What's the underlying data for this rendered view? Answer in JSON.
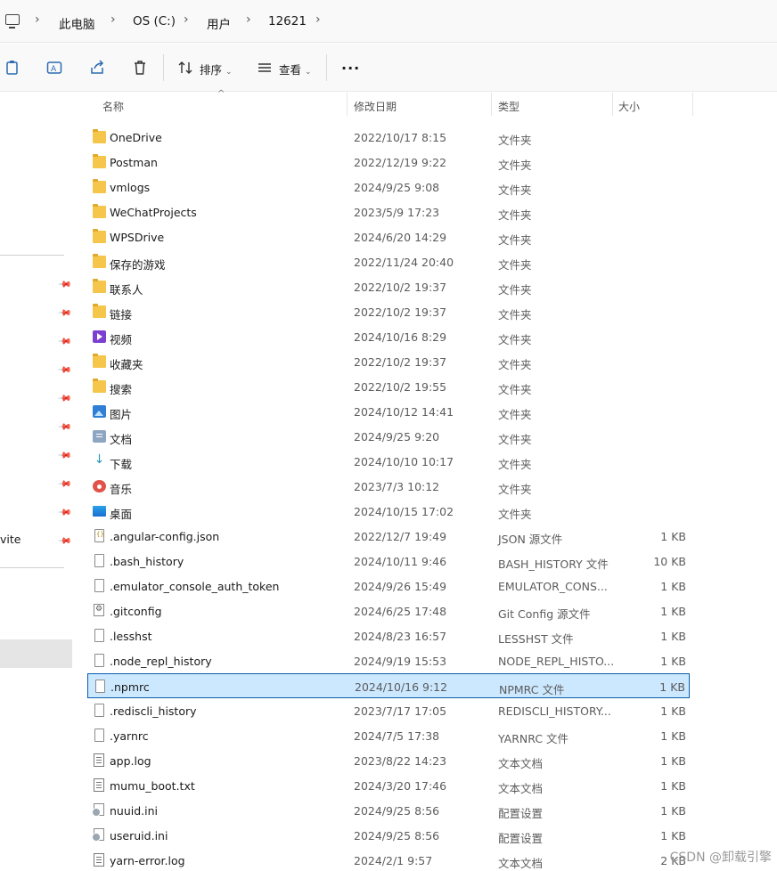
{
  "breadcrumb": {
    "items": [
      "此电脑",
      "OS (C:)",
      "用户",
      "12621"
    ]
  },
  "toolbar": {
    "sort_label": "排序",
    "view_label": "查看",
    "more_label": "···"
  },
  "sidebar": {
    "partial_label": "vite"
  },
  "columns": {
    "name": "名称",
    "date": "修改日期",
    "type": "类型",
    "size": "大小"
  },
  "rows": [
    {
      "icon": "folder",
      "name": "OneDrive",
      "date": "2022/10/17 8:15",
      "type": "文件夹",
      "size": ""
    },
    {
      "icon": "folder",
      "name": "Postman",
      "date": "2022/12/19 9:22",
      "type": "文件夹",
      "size": ""
    },
    {
      "icon": "folder",
      "name": "vmlogs",
      "date": "2024/9/25 9:08",
      "type": "文件夹",
      "size": ""
    },
    {
      "icon": "folder",
      "name": "WeChatProjects",
      "date": "2023/5/9 17:23",
      "type": "文件夹",
      "size": ""
    },
    {
      "icon": "folder",
      "name": "WPSDrive",
      "date": "2024/6/20 14:29",
      "type": "文件夹",
      "size": ""
    },
    {
      "icon": "folder",
      "name": "保存的游戏",
      "date": "2022/11/24 20:40",
      "type": "文件夹",
      "size": ""
    },
    {
      "icon": "folder",
      "name": "联系人",
      "date": "2022/10/2 19:37",
      "type": "文件夹",
      "size": ""
    },
    {
      "icon": "folder",
      "name": "链接",
      "date": "2022/10/2 19:37",
      "type": "文件夹",
      "size": ""
    },
    {
      "icon": "video",
      "name": "视频",
      "date": "2024/10/16 8:29",
      "type": "文件夹",
      "size": ""
    },
    {
      "icon": "folder",
      "name": "收藏夹",
      "date": "2022/10/2 19:37",
      "type": "文件夹",
      "size": ""
    },
    {
      "icon": "folder",
      "name": "搜索",
      "date": "2022/10/2 19:55",
      "type": "文件夹",
      "size": ""
    },
    {
      "icon": "pictures",
      "name": "图片",
      "date": "2024/10/12 14:41",
      "type": "文件夹",
      "size": ""
    },
    {
      "icon": "documents",
      "name": "文档",
      "date": "2024/9/25 9:20",
      "type": "文件夹",
      "size": ""
    },
    {
      "icon": "downloads",
      "name": "下载",
      "date": "2024/10/10 10:17",
      "type": "文件夹",
      "size": ""
    },
    {
      "icon": "music",
      "name": "音乐",
      "date": "2023/7/3 10:12",
      "type": "文件夹",
      "size": ""
    },
    {
      "icon": "desktop",
      "name": "桌面",
      "date": "2024/10/15 17:02",
      "type": "文件夹",
      "size": ""
    },
    {
      "icon": "json",
      "name": ".angular-config.json",
      "date": "2022/12/7 19:49",
      "type": "JSON 源文件",
      "size": "1 KB"
    },
    {
      "icon": "file",
      "name": ".bash_history",
      "date": "2024/10/11 9:46",
      "type": "BASH_HISTORY 文件",
      "size": "10 KB"
    },
    {
      "icon": "file",
      "name": ".emulator_console_auth_token",
      "date": "2024/9/26 15:49",
      "type": "EMULATOR_CONS...",
      "size": "1 KB"
    },
    {
      "icon": "gear",
      "name": ".gitconfig",
      "date": "2024/6/25 17:48",
      "type": "Git Config 源文件",
      "size": "1 KB"
    },
    {
      "icon": "file",
      "name": ".lesshst",
      "date": "2024/8/23 16:57",
      "type": "LESSHST 文件",
      "size": "1 KB"
    },
    {
      "icon": "file",
      "name": ".node_repl_history",
      "date": "2024/9/19 15:53",
      "type": "NODE_REPL_HISTO...",
      "size": "1 KB"
    },
    {
      "icon": "file",
      "name": ".npmrc",
      "date": "2024/10/16 9:12",
      "type": "NPMRC 文件",
      "size": "1 KB",
      "selected": true
    },
    {
      "icon": "file",
      "name": ".rediscli_history",
      "date": "2023/7/17 17:05",
      "type": "REDISCLI_HISTORY...",
      "size": "1 KB"
    },
    {
      "icon": "file",
      "name": ".yarnrc",
      "date": "2024/7/5 17:38",
      "type": "YARNRC 文件",
      "size": "1 KB"
    },
    {
      "icon": "textdoc",
      "name": "app.log",
      "date": "2023/8/22 14:23",
      "type": "文本文档",
      "size": "1 KB"
    },
    {
      "icon": "textdoc",
      "name": "mumu_boot.txt",
      "date": "2024/3/20 17:46",
      "type": "文本文档",
      "size": "1 KB"
    },
    {
      "icon": "ini",
      "name": "nuuid.ini",
      "date": "2024/9/25 8:56",
      "type": "配置设置",
      "size": "1 KB"
    },
    {
      "icon": "ini",
      "name": "useruid.ini",
      "date": "2024/9/25 8:56",
      "type": "配置设置",
      "size": "1 KB"
    },
    {
      "icon": "textdoc",
      "name": "yarn-error.log",
      "date": "2024/2/1 9:57",
      "type": "文本文档",
      "size": "2 KB"
    }
  ],
  "watermark": "CSDN @卸载引擎"
}
